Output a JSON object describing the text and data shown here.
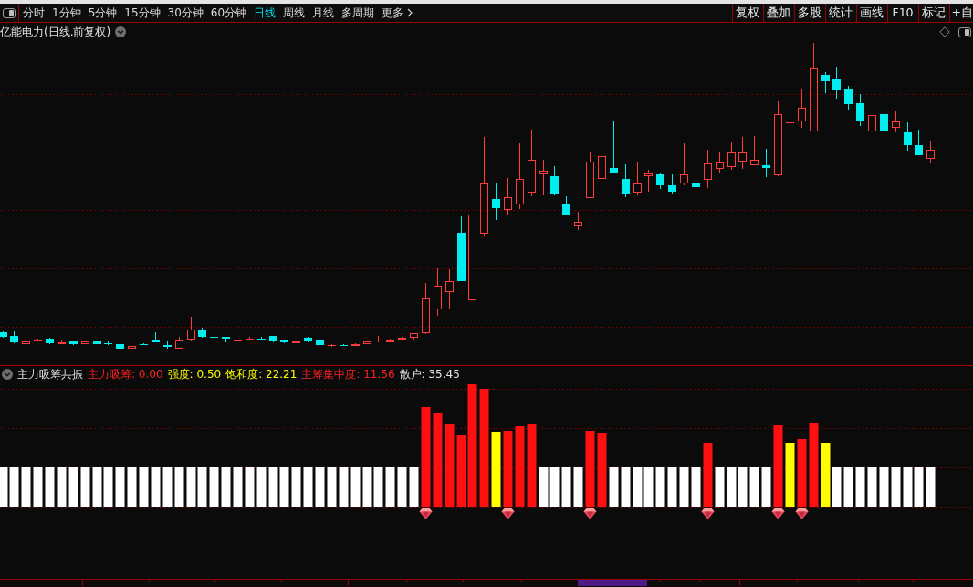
{
  "toolbar": {
    "periods": [
      {
        "label": "分时",
        "selected": false
      },
      {
        "label": "1分钟",
        "selected": false
      },
      {
        "label": "5分钟",
        "selected": false
      },
      {
        "label": "15分钟",
        "selected": false
      },
      {
        "label": "30分钟",
        "selected": false
      },
      {
        "label": "60分钟",
        "selected": false
      },
      {
        "label": "日线",
        "selected": true
      },
      {
        "label": "周线",
        "selected": false
      },
      {
        "label": "月线",
        "selected": false
      },
      {
        "label": "多周期",
        "selected": false
      }
    ],
    "more": {
      "label": "更多"
    },
    "tools": [
      "复权",
      "叠加",
      "多股",
      "统计",
      "画线",
      "F10",
      "标记",
      "+自"
    ]
  },
  "chart": {
    "title": "亿能电力(日线.前复权)"
  },
  "indicator": {
    "name": "主力吸筹共振",
    "readings": [
      {
        "text": "主力吸筹: 0.00",
        "color": "#ff2020"
      },
      {
        "text": "强度: 0.50",
        "color": "#ffff00"
      },
      {
        "text": "饱和度: 22.21",
        "color": "#ffff00"
      },
      {
        "text": "主筹集中度: 11.56",
        "color": "#ff2020"
      },
      {
        "text": "散户: 35.45",
        "color": "#e6e6e6"
      }
    ]
  }
}
